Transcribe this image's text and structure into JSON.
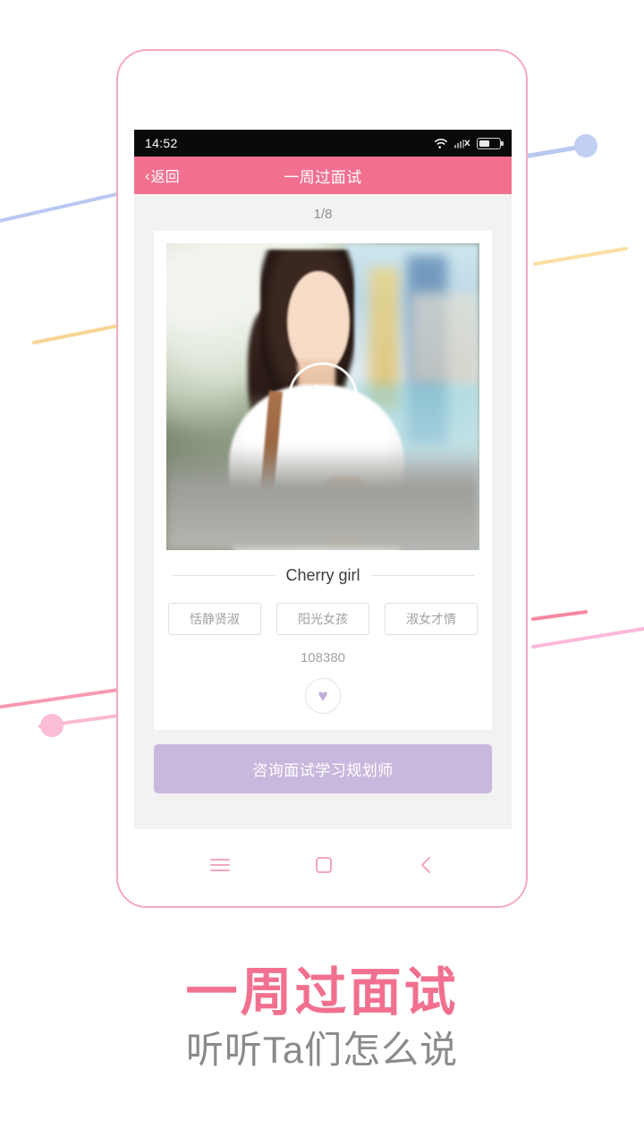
{
  "statusbar": {
    "time": "14:52",
    "wifi_icon": "wifi-icon",
    "signal_icon": "signal-no-service-icon",
    "battery_icon": "battery-icon"
  },
  "navbar": {
    "back_chevron": "‹",
    "back_label": "返回",
    "title": "一周过面试"
  },
  "content": {
    "pager": "1/8",
    "card": {
      "play_icon": "play-icon",
      "name": "Cherry girl",
      "tags": [
        "恬静贤淑",
        "阳光女孩",
        "淑女才情"
      ],
      "id_number": "108380",
      "like_icon": "♥"
    },
    "cta_label": "咨询面试学习规划师"
  },
  "phone_nav": {
    "menu_icon": "menu-icon",
    "home_icon": "home-square-icon",
    "back_icon": "back-chevron-icon"
  },
  "promo": {
    "headline": "一周过面试",
    "subhead": "听听Ta们怎么说"
  },
  "colors": {
    "brand_pink": "#f2708f",
    "frame_pink": "#f7a9c0",
    "cta_purple": "#c9b8dd",
    "heart_purple": "#c3aedb",
    "nav_icon_pink": "#f4a7bd",
    "subhead_gray": "#8a8a8a",
    "page_bg": "#ffffff",
    "screen_bg": "#f2f2f2"
  }
}
